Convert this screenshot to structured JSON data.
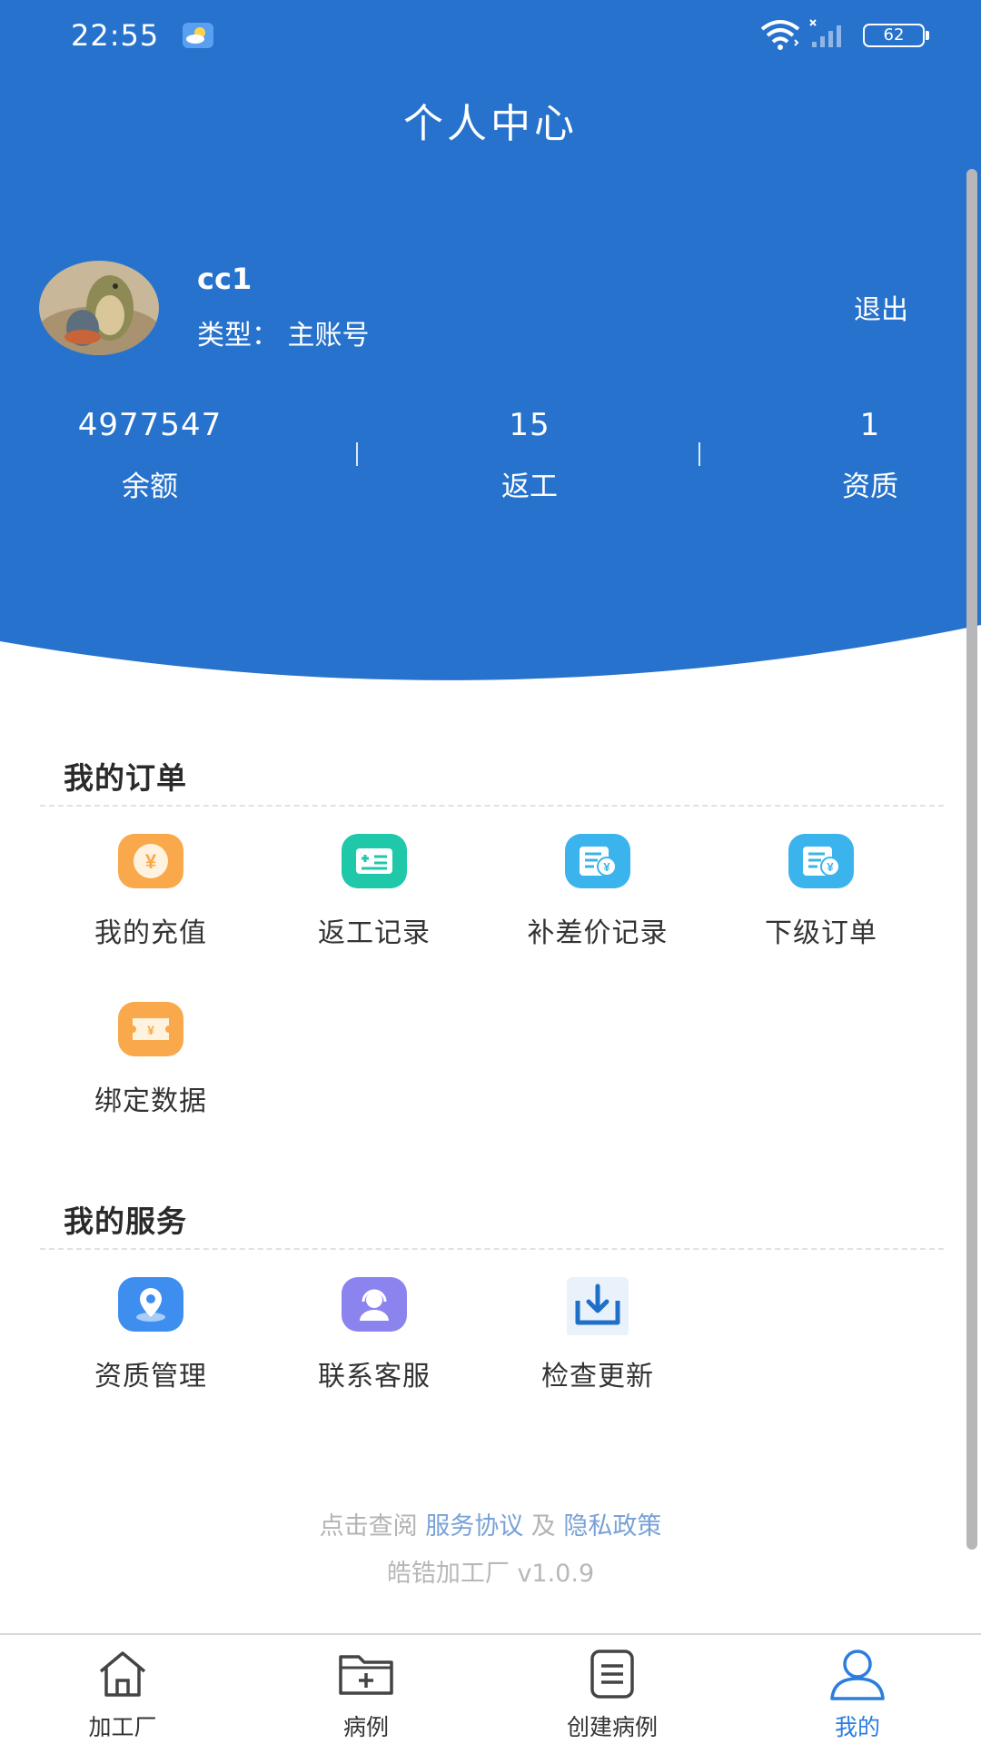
{
  "colors": {
    "primary": "#2672CC",
    "link": "#79A1D6",
    "active_tab": "#2B7DE0"
  },
  "status_bar": {
    "time": "22:55",
    "battery": "62"
  },
  "header": {
    "title": "个人中心"
  },
  "user": {
    "name": "cc1",
    "type": "类型： 主账号",
    "logout_label": "退出"
  },
  "stats": [
    {
      "value": "4977547",
      "label": "余额"
    },
    {
      "value": "15",
      "label": "返工"
    },
    {
      "value": "1",
      "label": "资质"
    }
  ],
  "orders": {
    "title": "我的订单",
    "items": [
      {
        "label": "我的充值",
        "icon": "recharge-yuan-icon"
      },
      {
        "label": "返工记录",
        "icon": "rework-record-icon"
      },
      {
        "label": "补差价记录",
        "icon": "price-difference-record-icon"
      },
      {
        "label": "下级订单",
        "icon": "sub-order-icon"
      },
      {
        "label": "绑定数据",
        "icon": "bind-data-ticket-icon"
      }
    ]
  },
  "services": {
    "title": "我的服务",
    "items": [
      {
        "label": "资质管理",
        "icon": "location-pin-icon"
      },
      {
        "label": "联系客服",
        "icon": "customer-service-icon"
      },
      {
        "label": "检查更新",
        "icon": "download-update-icon"
      }
    ]
  },
  "footer": {
    "policy_prefix": "点击查阅",
    "service_agreement": "服务协议",
    "and": "及",
    "privacy_policy": "隐私政策",
    "version": "皓锆加工厂 v1.0.9"
  },
  "tabbar": [
    {
      "label": "加工厂",
      "icon": "home-icon"
    },
    {
      "label": "病例",
      "icon": "folder-plus-icon"
    },
    {
      "label": "创建病例",
      "icon": "document-list-icon"
    },
    {
      "label": "我的",
      "icon": "user-icon",
      "active": true
    }
  ]
}
